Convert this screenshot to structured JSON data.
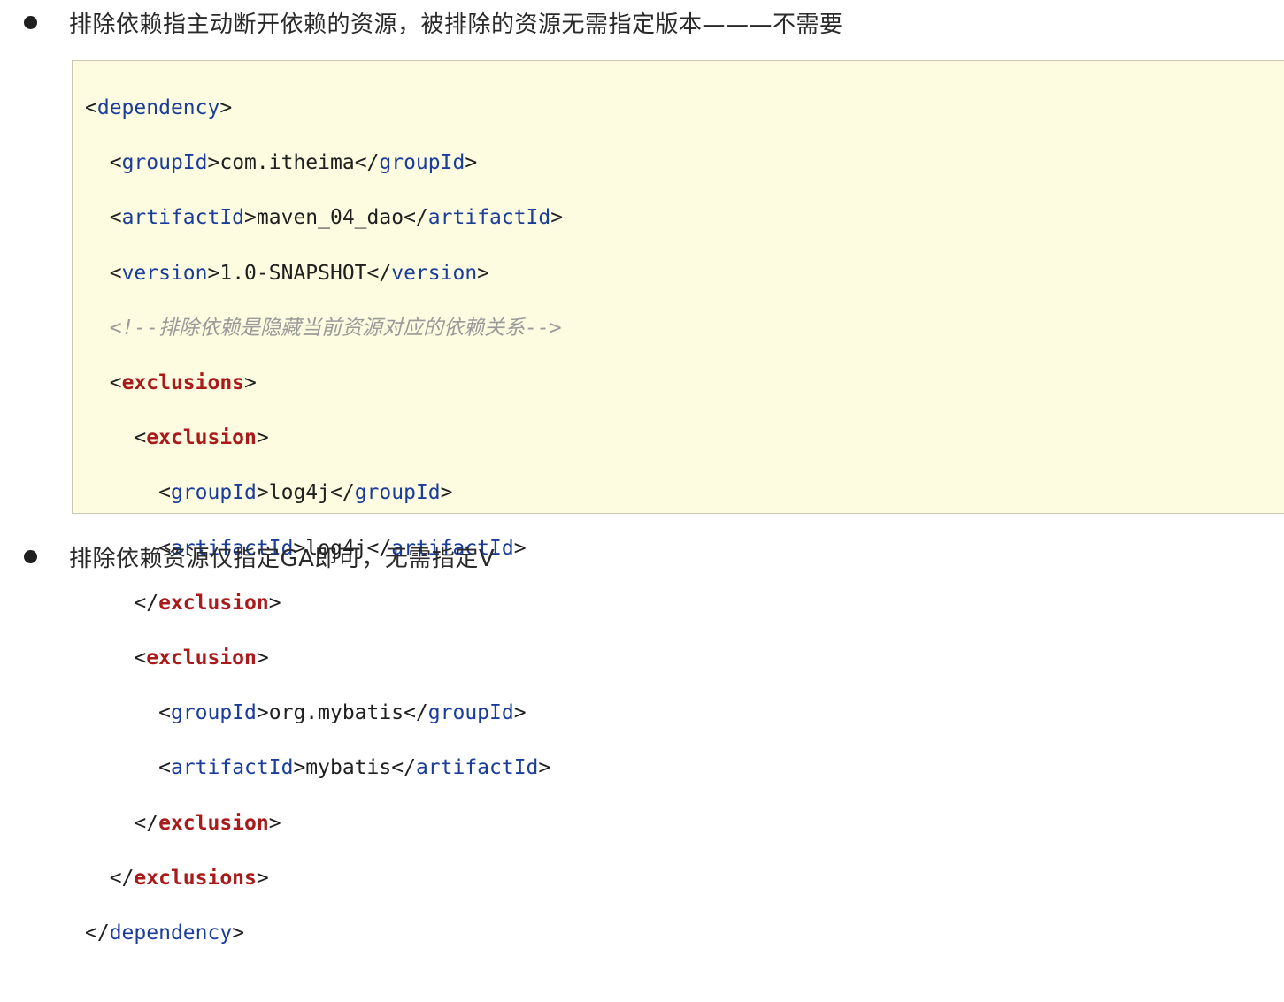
{
  "bullets": [
    "排除依赖指主动断开依赖的资源，被排除的资源无需指定版本———不需要",
    "排除依赖资源仅指定GA即可，无需指定V"
  ],
  "code": {
    "dependency_tag": "dependency",
    "groupId_tag": "groupId",
    "artifactId_tag": "artifactId",
    "version_tag": "version",
    "exclusions_tag": "exclusions",
    "exclusion_tag": "exclusion",
    "dep_groupId": "com.itheima",
    "dep_artifactId": "maven_04_dao",
    "dep_version": "1.0-SNAPSHOT",
    "comment": "<!--排除依赖是隐藏当前资源对应的依赖关系-->",
    "excl1_groupId": "log4j",
    "excl1_artifactId": "log4j",
    "excl2_groupId": "org.mybatis",
    "excl2_artifactId": "mybatis"
  }
}
